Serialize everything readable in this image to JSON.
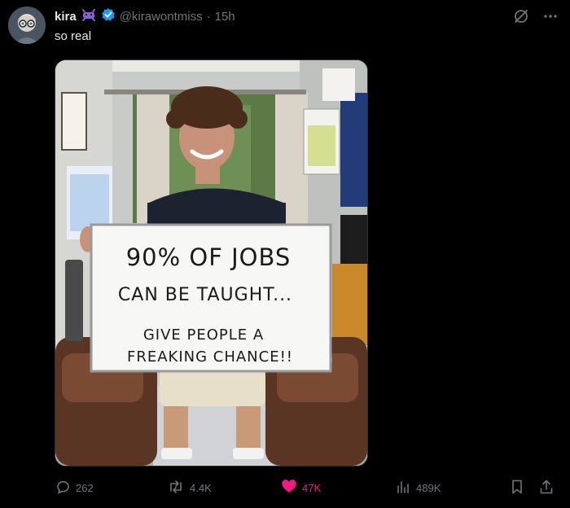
{
  "tweet": {
    "author_name": "kira",
    "handle": "@kirawontmiss",
    "separator": "·",
    "time": "15h",
    "text": "so real"
  },
  "media": {
    "sign_lines": [
      "90% OF JOBS",
      "CAN BE TAUGHT...",
      "GIVE PEOPLE A",
      "FREAKING CHANCE!!"
    ]
  },
  "actions": {
    "replies": "262",
    "reposts": "4.4K",
    "likes": "47K",
    "views": "489K"
  },
  "colors": {
    "like_active": "#f91880",
    "verified": "#1d9bf0",
    "muted": "#71767b"
  }
}
